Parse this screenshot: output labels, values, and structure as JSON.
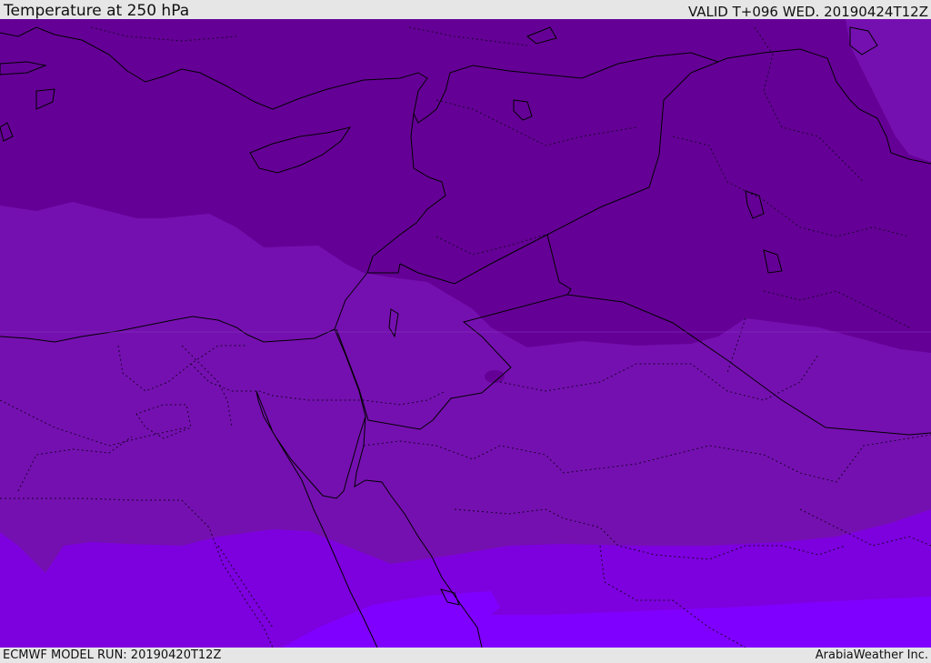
{
  "header": {
    "title": "Temperature at 250 hPa",
    "valid": "VALID T+096 WED. 20190424T12Z"
  },
  "footer": {
    "model_run": "ECMWF MODEL RUN: 20190420T12Z",
    "credit": "ArabiaWeather Inc."
  },
  "map": {
    "palette": {
      "coldest": "#650096",
      "cold": "#7510b0",
      "mid": "#7d00de",
      "warm": "#8000ff",
      "border": "#000000"
    }
  }
}
